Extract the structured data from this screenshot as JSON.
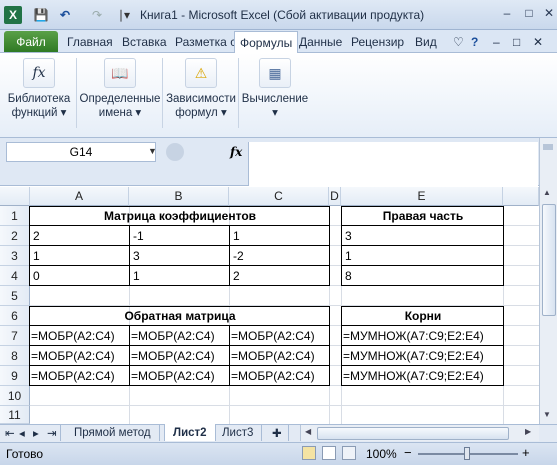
{
  "window": {
    "title": "Книга1  -  Microsoft Excel (Сбой активации продукта)",
    "qat": {
      "save_icon": "💾",
      "undo_icon": "↶",
      "redo_icon": "↷",
      "customize": "∣▾"
    },
    "controls": {
      "minimize": "–",
      "maximize": "□",
      "close": "✕"
    }
  },
  "ribbon_tabs": [
    "Файл",
    "Главная",
    "Вставка",
    "Разметка с",
    "Формулы",
    "Данные",
    "Рецензир",
    "Вид"
  ],
  "ribbon_right": {
    "help": "♡",
    "help2": "?",
    "min": "–",
    "restore": "□",
    "close": "✕"
  },
  "ribbon_groups": [
    {
      "icon": "fx",
      "label1": "Библиотека",
      "label2": "функций ▾"
    },
    {
      "icon": "📖",
      "label1": "Определенные",
      "label2": "имена ▾"
    },
    {
      "icon": "⚠",
      "label1": "Зависимости",
      "label2": "формул ▾"
    },
    {
      "icon": "▦",
      "label1": "Вычисление",
      "label2": "▾"
    }
  ],
  "formula_bar": {
    "name_box": "G14",
    "fx": "fx",
    "value": ""
  },
  "columns": [
    "A",
    "B",
    "C",
    "D",
    "E"
  ],
  "rows": [
    "1",
    "2",
    "3",
    "4",
    "5",
    "6",
    "7",
    "8",
    "9",
    "10",
    "11"
  ],
  "cells": {
    "coef_title": "Матрица коэффициентов",
    "rhs_title": "Правая часть",
    "A2": "2",
    "B2": "-1",
    "C2": "1",
    "E2": "3",
    "A3": "1",
    "B3": "3",
    "C3": "-2",
    "E3": "1",
    "A4": "0",
    "B4": "1",
    "C4": "2",
    "E4": "8",
    "inv_title": "Обратная матрица",
    "roots_title": "Корни",
    "A7": "=МОБР(A2:C4)",
    "B7": "=МОБР(A2:C4)",
    "C7": "=МОБР(A2:C4)",
    "E7": "=МУМНОЖ(A7:C9;E2:E4)",
    "A8": "=МОБР(A2:C4)",
    "B8": "=МОБР(A2:C4)",
    "C8": "=МОБР(A2:C4)",
    "E8": "=МУМНОЖ(A7:C9;E2:E4)",
    "A9": "=МОБР(A2:C4)",
    "B9": "=МОБР(A2:C4)",
    "C9": "=МОБР(A2:C4)",
    "E9": "=МУМНОЖ(A7:C9;E2:E4)"
  },
  "sheets": {
    "nav": [
      "⇤",
      "◂",
      "▸",
      "⇥"
    ],
    "tabs": [
      "Прямой метод",
      "Лист2",
      "Лист3"
    ],
    "active": "Лист2"
  },
  "status": {
    "ready": "Готово",
    "zoom": "100%",
    "minus": "−",
    "plus": "+"
  },
  "colors": {
    "accent": "#2f7a24",
    "ribbon": "#dbe6f4"
  }
}
